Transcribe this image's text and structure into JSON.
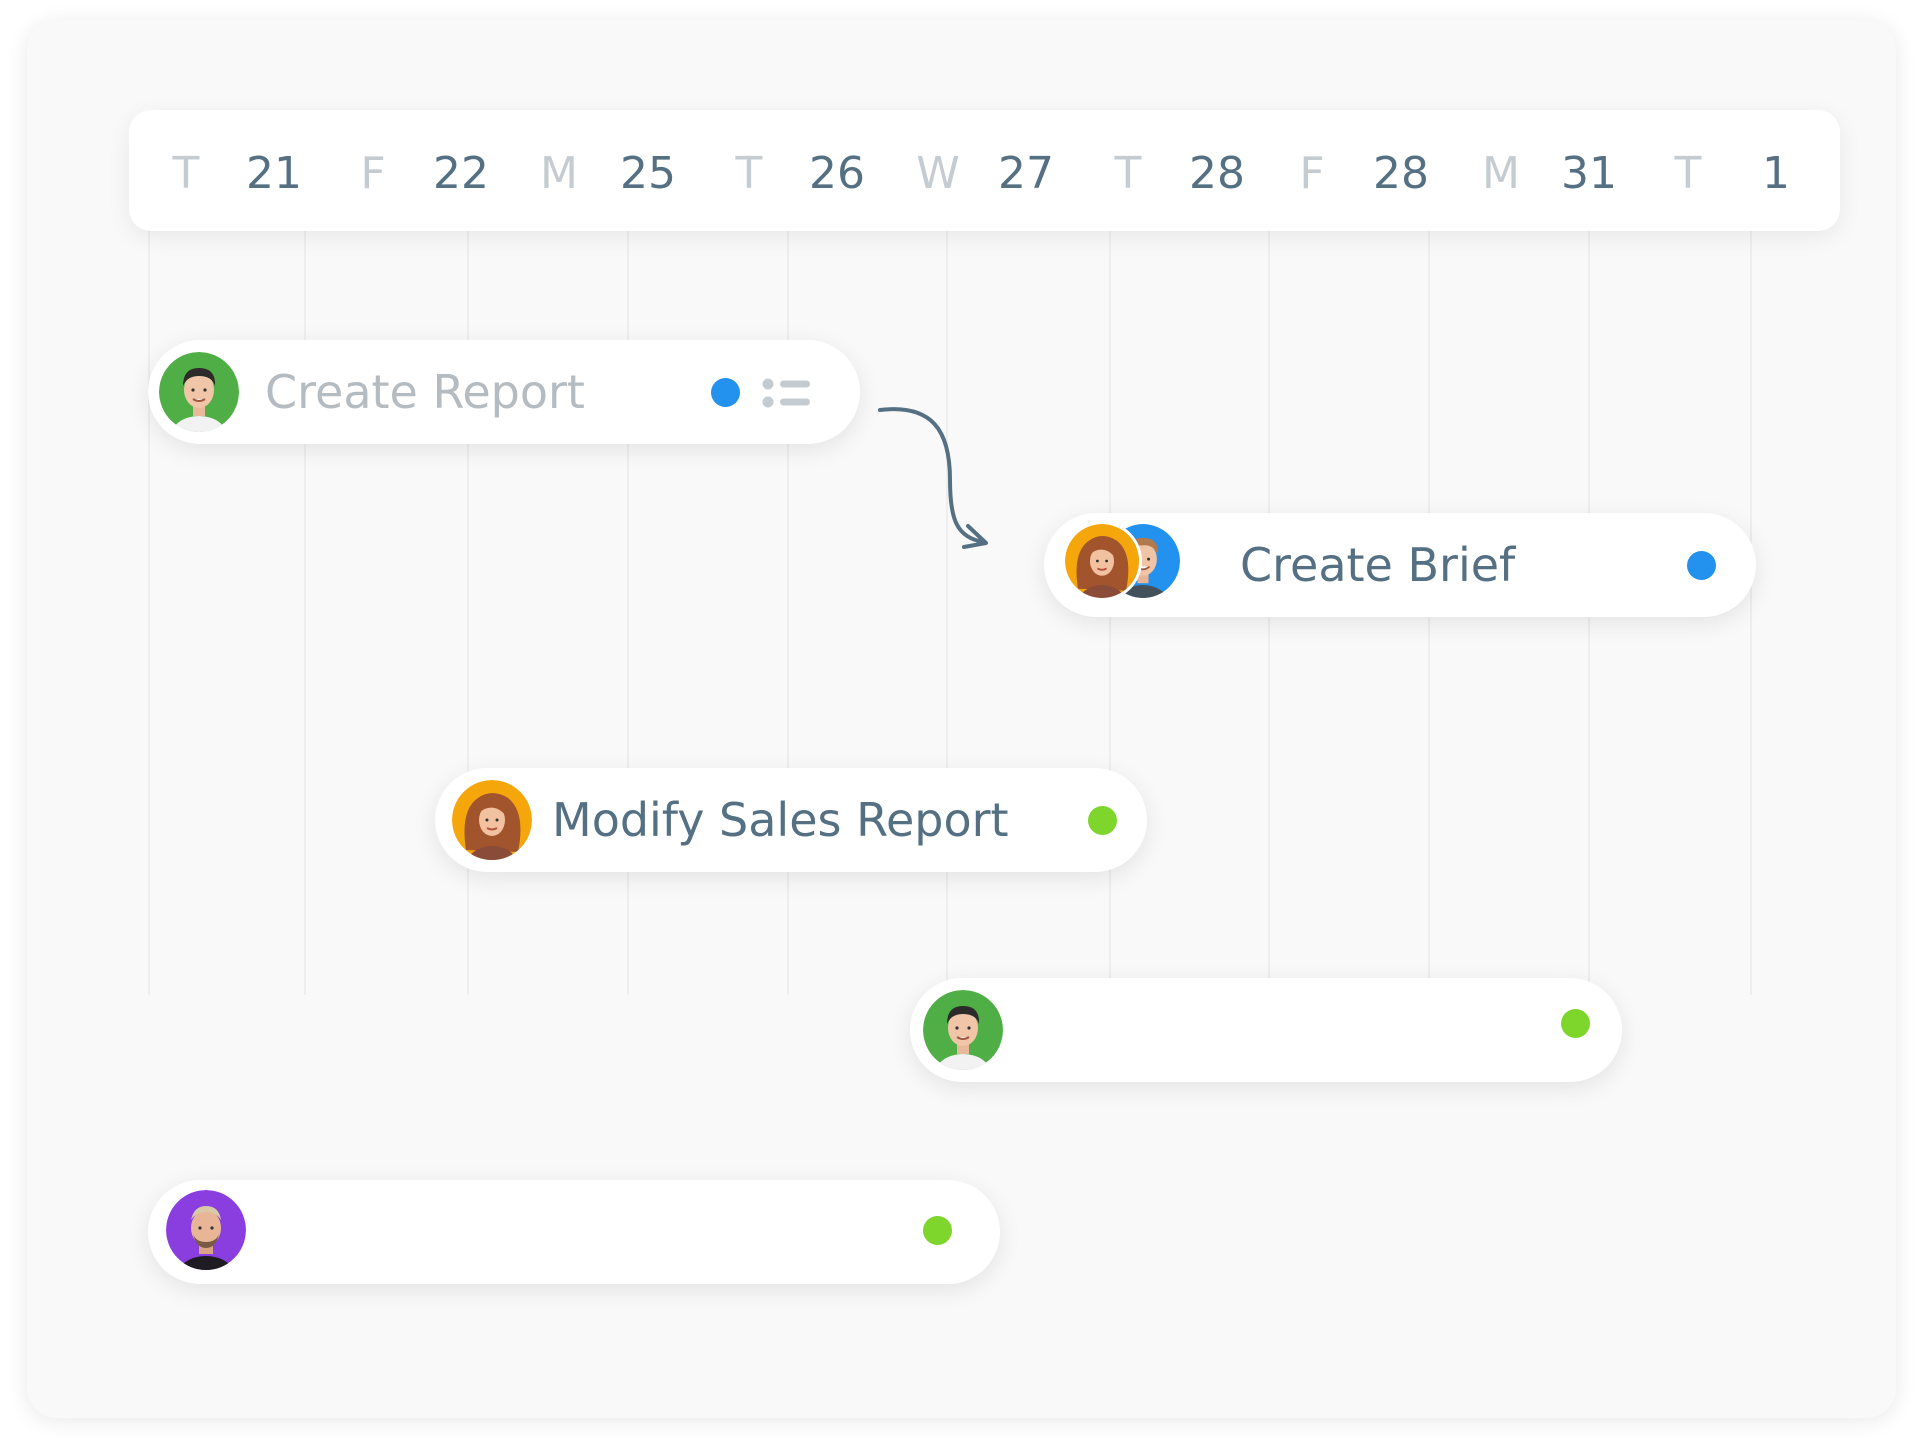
{
  "colors": {
    "background": "#f9f9f9",
    "day_letter": "#c5ccd1",
    "day_number": "#547082",
    "label_muted": "#b4bcc2",
    "label_active": "#547082",
    "blue_status": "#2392ee",
    "green_status": "#7ed52b",
    "connector": "#547082"
  },
  "timeline": {
    "dates": [
      {
        "day": "T",
        "num": "21"
      },
      {
        "day": "F",
        "num": "22"
      },
      {
        "day": "M",
        "num": "25"
      },
      {
        "day": "T",
        "num": "26"
      },
      {
        "day": "W",
        "num": "27"
      },
      {
        "day": "T",
        "num": "28"
      },
      {
        "day": "F",
        "num": "28"
      },
      {
        "day": "M",
        "num": "31"
      },
      {
        "day": "T",
        "num": "1"
      }
    ]
  },
  "tasks": [
    {
      "label": "Create Report",
      "assignees": [
        "man-green-bg"
      ],
      "status_color": "#2392ee",
      "has_subtasks": true
    },
    {
      "label": "Create Brief",
      "assignees": [
        "woman-orange-bg",
        "man-blue-bg"
      ],
      "status_color": "#2392ee",
      "has_subtasks": false
    },
    {
      "label": "Modify Sales Report",
      "assignees": [
        "woman-orange-bg"
      ],
      "status_color": "#7ed52b",
      "has_subtasks": false
    },
    {
      "label": "",
      "assignees": [
        "man-green-bg"
      ],
      "status_color": "#7ed52b",
      "has_subtasks": false
    },
    {
      "label": "",
      "assignees": [
        "man-purple-bg"
      ],
      "status_color": "#7ed52b",
      "has_subtasks": false
    }
  ]
}
